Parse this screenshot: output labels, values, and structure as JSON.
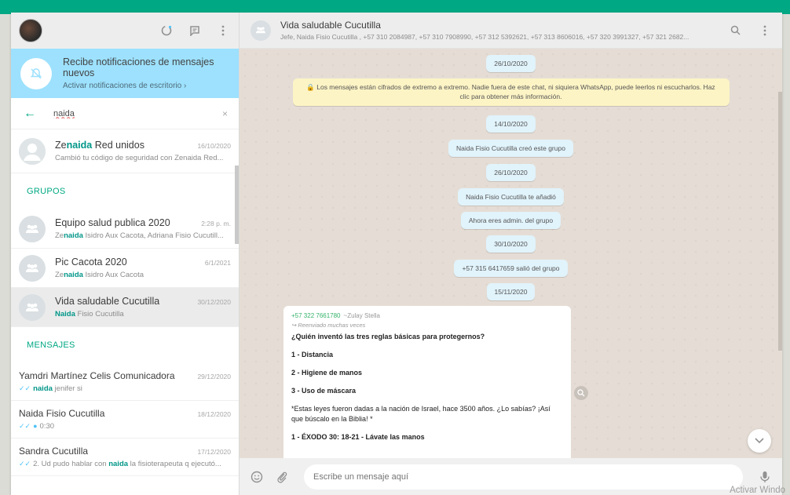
{
  "sidebar": {
    "notification": {
      "title": "Recibe notificaciones de mensajes nuevos",
      "subtitle": "Activar notificaciones de escritorio ›"
    },
    "search": {
      "value": "naida",
      "clear": "×"
    },
    "contacts": [
      {
        "name_prefix": "Ze",
        "name_match": "naida",
        "name_suffix": " Red unidos",
        "time": "16/10/2020",
        "preview": "Cambió tu código de seguridad con Zenaida Red..."
      }
    ],
    "groups_heading": "GRUPOS",
    "groups": [
      {
        "name": "Equipo salud publica 2020",
        "time": "2:28 p. m.",
        "preview_prefix": "Ze",
        "preview_match": "naida",
        "preview_rest": " Isidro Aux Cacota, Adriana Fisio Cucutill..."
      },
      {
        "name": "Pic Cacota 2020",
        "time": "6/1/2021",
        "preview_prefix": "Ze",
        "preview_match": "naida",
        "preview_rest": " Isidro Aux Cacota"
      },
      {
        "name": "Vida saludable Cucutilla",
        "time": "30/12/2020",
        "preview_prefix": "",
        "preview_match": "Naida",
        "preview_rest": " Fisio Cucutilla",
        "selected": true
      }
    ],
    "messages_heading": "MENSAJES",
    "messages": [
      {
        "name": "Yamdri Martínez Celis Comunicadora",
        "time": "29/12/2020",
        "preview_prefix": "",
        "preview_match": "naida",
        "preview_rest": " jenifer si"
      },
      {
        "name": "Naida Fisio Cucutilla",
        "time": "18/12/2020",
        "preview_prefix": "",
        "preview_match": "",
        "preview_rest": "0:30"
      },
      {
        "name": "Sandra Cucutilla",
        "time": "17/12/2020",
        "preview_prefix": "2. Ud pudo hablar con ",
        "preview_match": "naida",
        "preview_rest": " la fisioterapeuta q ejecutó..."
      }
    ]
  },
  "chat": {
    "title": "Vida saludable Cucutilla",
    "members": "Jefe, Naida Fisio Cucutilla , +57 310 2084987, +57 310 7908990, +57 312 5392621, +57 313 8606016, +57 320 3991327, +57 321 2682...",
    "system": [
      "26/10/2020",
      "🔒 Los mensajes están cifrados de extremo a extremo. Nadie fuera de este chat, ni siquiera WhatsApp, puede leerlos ni escucharlos. Haz clic para obtener más información.",
      "14/10/2020",
      "Naida Fisio Cucutilla creó este grupo",
      "26/10/2020",
      "Naida Fisio Cucutilla te añadió",
      "Ahora eres admin. del grupo",
      "30/10/2020",
      "+57 315 6417659 salió del grupo",
      "15/11/2020"
    ],
    "message": {
      "sender": "+57 322 7661780",
      "alias": "~Zulay Stella",
      "forwarded": "↪ Reenviado muchas veces",
      "lines": [
        "¿Quién inventó las tres reglas básicas para protegernos?",
        "1 - Distancia",
        "2 - Higiene de manos",
        "3 - Uso de máscara",
        "*Estas leyes fueron dadas a la nación de Israel, hace 3500 años. ¿Lo sabías? ¡Así que búscalo en la Biblia! *",
        "1 - ÉXODO 30: 18-21 - Lávate las manos"
      ]
    },
    "composer_placeholder": "Escribe un mensaje aquí"
  },
  "watermark": "Activar Windo",
  "colors": {
    "accent": "#00a884",
    "notification": "#9de1fe",
    "chat_bg": "#e5ddd5"
  }
}
